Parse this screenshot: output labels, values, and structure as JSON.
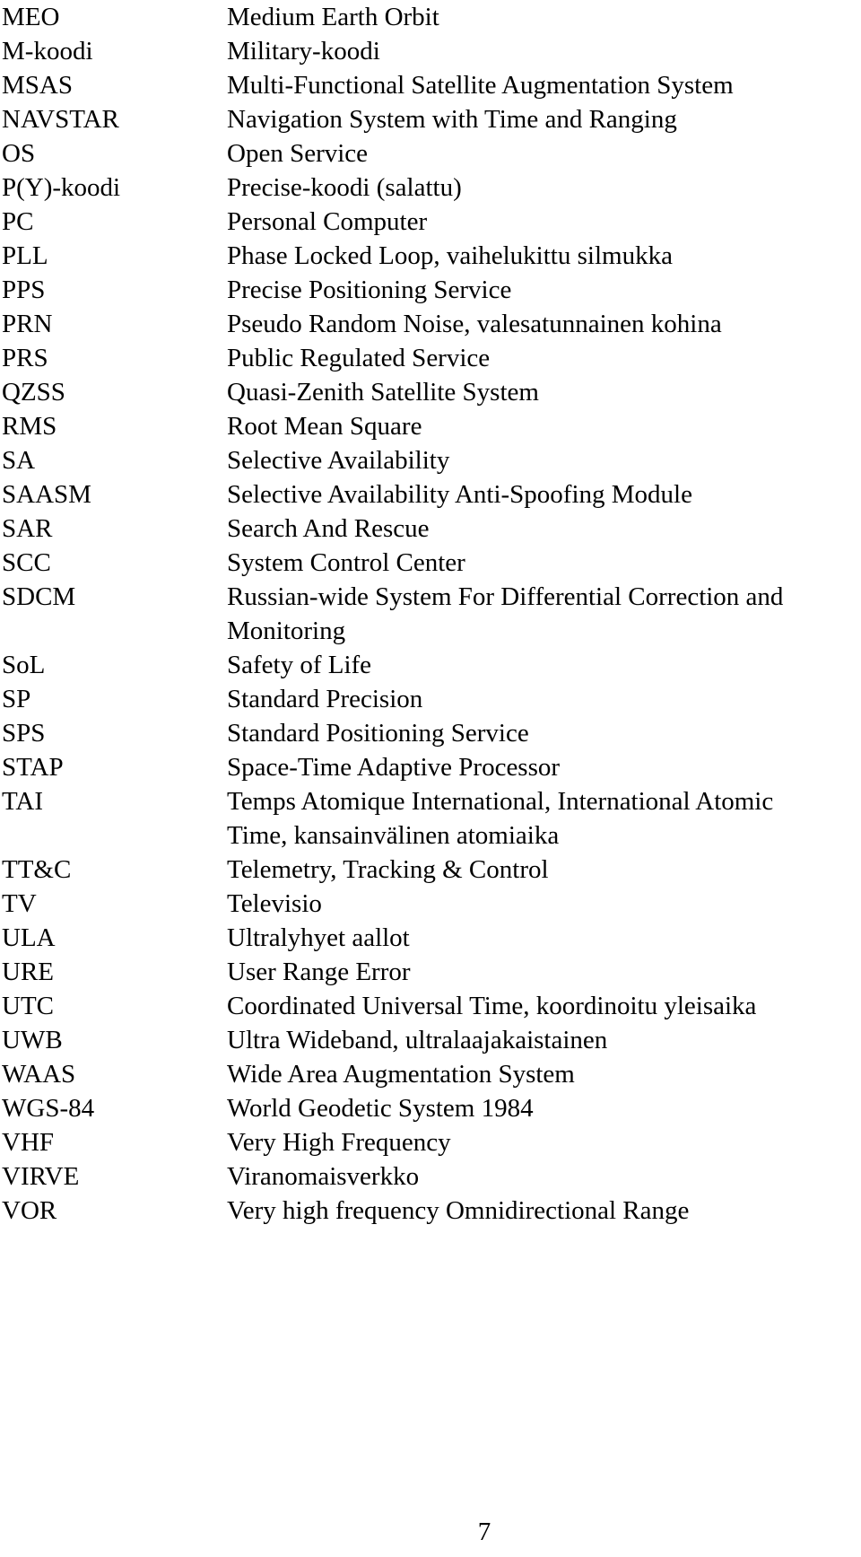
{
  "document": {
    "type": "abbreviations-glossary",
    "page_number": "7",
    "entries": [
      {
        "abbr": "MEO",
        "lines": [
          "Medium Earth Orbit"
        ]
      },
      {
        "abbr": "M-koodi",
        "lines": [
          "Military-koodi"
        ]
      },
      {
        "abbr": "MSAS",
        "lines": [
          "Multi-Functional Satellite Augmentation System"
        ]
      },
      {
        "abbr": "NAVSTAR",
        "lines": [
          "Navigation System with Time and Ranging"
        ]
      },
      {
        "abbr": "OS",
        "lines": [
          "Open Service"
        ]
      },
      {
        "abbr": "P(Y)-koodi",
        "lines": [
          "Precise-koodi (salattu)"
        ]
      },
      {
        "abbr": "PC",
        "lines": [
          "Personal Computer"
        ]
      },
      {
        "abbr": "PLL",
        "lines": [
          "Phase Locked Loop, vaihelukittu silmukka"
        ]
      },
      {
        "abbr": "PPS",
        "lines": [
          "Precise Positioning Service"
        ]
      },
      {
        "abbr": "PRN",
        "lines": [
          "Pseudo Random Noise, valesatunnainen kohina"
        ]
      },
      {
        "abbr": "PRS",
        "lines": [
          "Public Regulated Service"
        ]
      },
      {
        "abbr": "QZSS",
        "lines": [
          "Quasi-Zenith Satellite System"
        ]
      },
      {
        "abbr": "RMS",
        "lines": [
          "Root Mean Square"
        ]
      },
      {
        "abbr": "SA",
        "lines": [
          "Selective Availability"
        ]
      },
      {
        "abbr": "SAASM",
        "lines": [
          "Selective Availability Anti-Spoofing Module"
        ]
      },
      {
        "abbr": "SAR",
        "lines": [
          "Search And Rescue"
        ]
      },
      {
        "abbr": "SCC",
        "lines": [
          "System Control Center"
        ]
      },
      {
        "abbr": "SDCM",
        "lines": [
          "Russian-wide System For Differential Correction and",
          "Monitoring"
        ]
      },
      {
        "abbr": "SoL",
        "lines": [
          "Safety of Life"
        ]
      },
      {
        "abbr": "SP",
        "lines": [
          "Standard Precision"
        ]
      },
      {
        "abbr": "SPS",
        "lines": [
          "Standard Positioning Service"
        ]
      },
      {
        "abbr": "STAP",
        "lines": [
          "Space-Time Adaptive Processor"
        ]
      },
      {
        "abbr": "TAI",
        "lines": [
          "Temps Atomique International, International Atomic",
          "Time, kansainvälinen atomiaika"
        ]
      },
      {
        "abbr": "TT&C",
        "lines": [
          "Telemetry, Tracking & Control"
        ]
      },
      {
        "abbr": "TV",
        "lines": [
          "Televisio"
        ]
      },
      {
        "abbr": "ULA",
        "lines": [
          "Ultralyhyet aallot"
        ]
      },
      {
        "abbr": "URE",
        "lines": [
          "User Range Error"
        ]
      },
      {
        "abbr": "UTC",
        "lines": [
          "Coordinated Universal Time, koordinoitu yleisaika"
        ]
      },
      {
        "abbr": "UWB",
        "lines": [
          "Ultra Wideband, ultralaajakaistainen"
        ]
      },
      {
        "abbr": "WAAS",
        "lines": [
          "Wide Area Augmentation System"
        ]
      },
      {
        "abbr": "WGS-84",
        "lines": [
          "World Geodetic System 1984"
        ]
      },
      {
        "abbr": "VHF",
        "lines": [
          "Very High Frequency"
        ]
      },
      {
        "abbr": "VIRVE",
        "lines": [
          "Viranomaisverkko"
        ]
      },
      {
        "abbr": "VOR",
        "lines": [
          "Very high frequency Omnidirectional Range"
        ]
      }
    ]
  }
}
